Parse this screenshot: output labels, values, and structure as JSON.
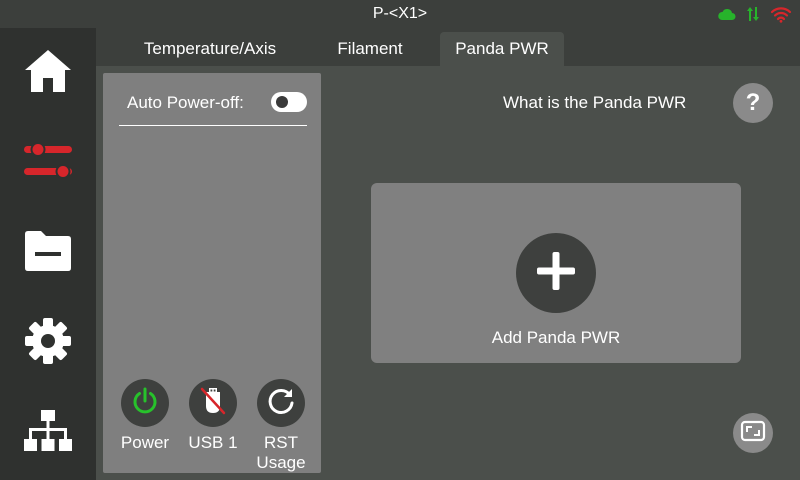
{
  "titlebar": {
    "title": "P-<X1>",
    "icons": [
      "cloud-icon",
      "sync-arrows-icon",
      "wifi-icon"
    ],
    "colors": {
      "cloud": "#27b32b",
      "sync": "#27b32b",
      "wifi": "#d7262b"
    }
  },
  "sidebar": {
    "items": [
      {
        "icon": "home-icon"
      },
      {
        "icon": "controls-sliders-icon",
        "active": true
      },
      {
        "icon": "folder-icon"
      },
      {
        "icon": "gear-icon"
      },
      {
        "icon": "network-icon"
      }
    ],
    "active_color": "#d7262b"
  },
  "tabs": [
    {
      "label": "Temperature/Axis"
    },
    {
      "label": "Filament"
    },
    {
      "label": "Panda PWR",
      "active": true
    }
  ],
  "left_panel": {
    "auto_power_off_label": "Auto Power-off:",
    "auto_power_off_on": false,
    "controls": [
      {
        "label": "Power",
        "icon": "power-icon"
      },
      {
        "label": "USB 1",
        "icon": "usb-disabled-icon"
      },
      {
        "label": "RST\nUsage",
        "icon": "refresh-icon"
      }
    ]
  },
  "main": {
    "help_text": "What is the Panda PWR",
    "help_button": "?",
    "add_label": "Add Panda PWR"
  }
}
